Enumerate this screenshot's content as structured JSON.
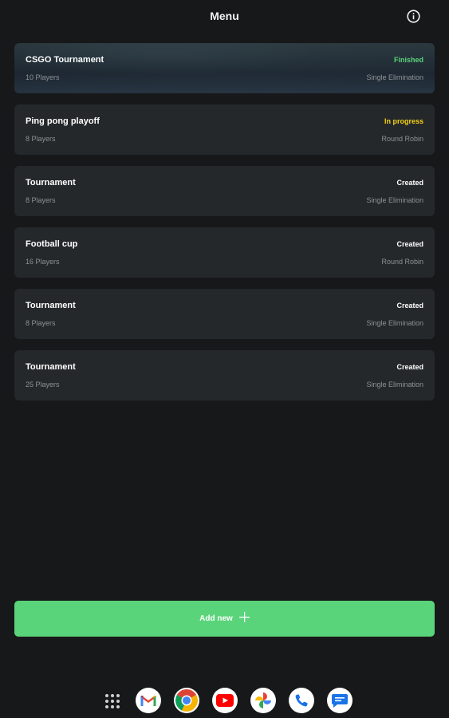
{
  "header": {
    "title": "Menu",
    "info_icon": "info-icon"
  },
  "tournaments": [
    {
      "name": "CSGO Tournament",
      "players": "10 Players",
      "status": "Finished",
      "format": "Single Elimination"
    },
    {
      "name": "Ping pong playoff",
      "players": "8 Players",
      "status": "In progress",
      "format": "Round Robin"
    },
    {
      "name": "Tournament",
      "players": "8 Players",
      "status": "Created",
      "format": "Single Elimination"
    },
    {
      "name": "Football cup",
      "players": "16 Players",
      "status": "Created",
      "format": "Round Robin"
    },
    {
      "name": "Tournament",
      "players": "8 Players",
      "status": "Created",
      "format": "Single Elimination"
    },
    {
      "name": "Tournament",
      "players": "25 Players",
      "status": "Created",
      "format": "Single Elimination"
    }
  ],
  "add_button": {
    "label": "Add new",
    "icon": "plus-icon"
  },
  "dock": {
    "apps": [
      "app-grid-icon",
      "gmail-icon",
      "chrome-icon",
      "youtube-icon",
      "photos-icon",
      "phone-icon",
      "messages-icon"
    ]
  },
  "colors": {
    "background": "#17181a",
    "card": "#25282b",
    "accent_green": "#5ad47a",
    "status_in_progress": "#f5d214",
    "muted_text": "#8d9194"
  }
}
